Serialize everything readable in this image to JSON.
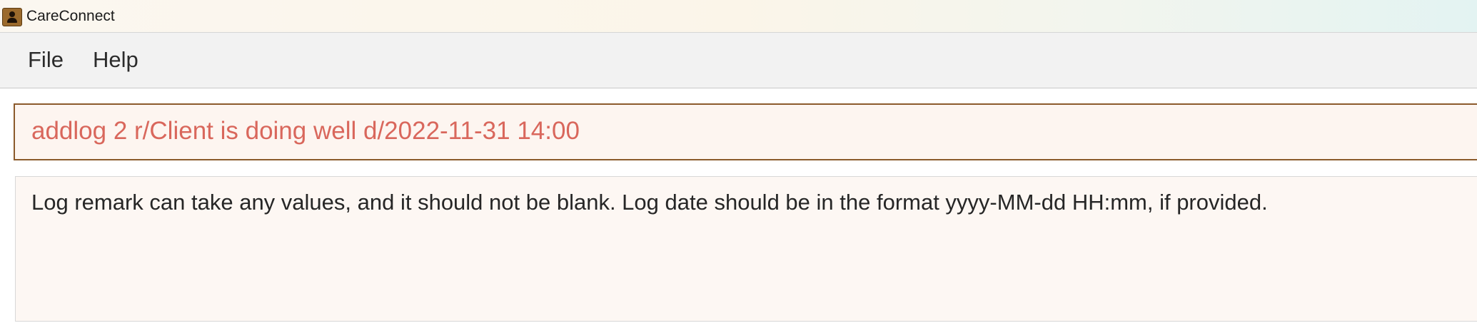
{
  "window": {
    "title": "CareConnect",
    "icon": "address-book-icon"
  },
  "menu": {
    "items": [
      {
        "label": "File"
      },
      {
        "label": "Help"
      }
    ]
  },
  "command": {
    "value": "addlog 2 r/Client is doing well d/2022-11-31 14:00",
    "text_color": "#d9675c"
  },
  "result": {
    "message": "Log remark can take any values, and it should not be blank. Log date should be in the format yyyy-MM-dd HH:mm, if provided."
  }
}
